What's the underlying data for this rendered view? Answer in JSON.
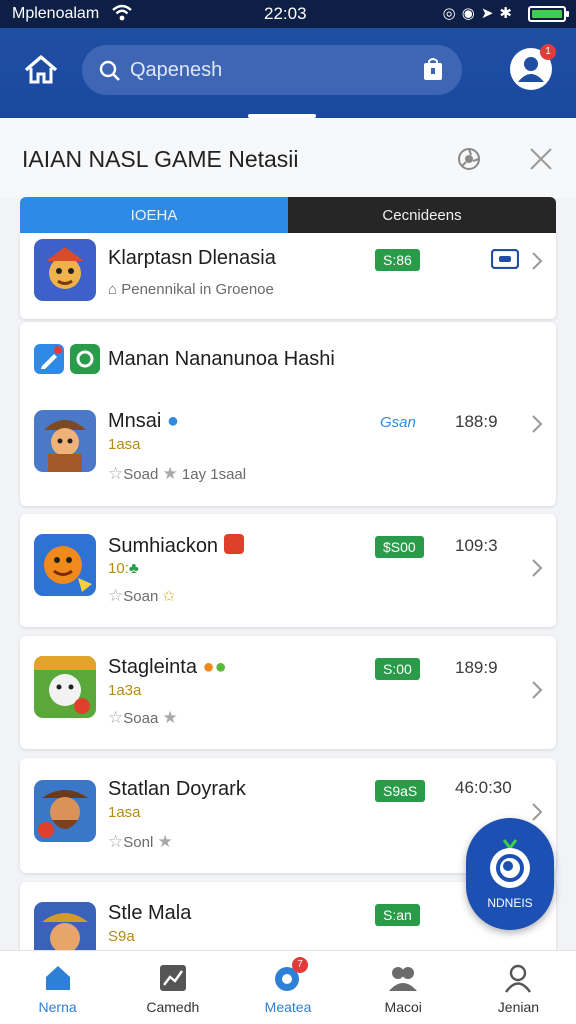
{
  "status_bar": {
    "carrier": "Mplenoalam",
    "time": "22:03",
    "battery_level": 1.0
  },
  "header": {
    "search_placeholder": "Qapenesh",
    "profile_badge": "1"
  },
  "title": "IAIAN NASL GAME Netasii",
  "tabs": [
    {
      "label": "IOEHA",
      "active": true
    },
    {
      "label": "Cecnideens",
      "active": false
    }
  ],
  "section_header": {
    "label": "Manan Nananunoa Hashi"
  },
  "games": [
    {
      "name": "Klarptasn Dlenasia",
      "meta": "Penennikal in Groenoe",
      "price": "S:86",
      "tag": ""
    },
    {
      "name": "Mnsai",
      "sub": "1asa",
      "meta1": "Soad",
      "meta2": "1ay  1saal",
      "tag": "Gsan",
      "score": "188:9"
    },
    {
      "name": "Sumhiackon",
      "sub": "10:",
      "meta1": "Soan",
      "price": "$S00",
      "score": "109:3"
    },
    {
      "name": "Stagleinta",
      "sub": "1a3a",
      "meta1": "Soaa",
      "price": "S:00",
      "score": "189:9"
    },
    {
      "name": "Statlan Doyrark",
      "sub": "1asa",
      "meta1": "Sonl",
      "price": "S9aS",
      "score": "46:0:30"
    },
    {
      "name": "Stle Mala",
      "sub": "S9a",
      "price": "S:an"
    }
  ],
  "fab": {
    "label": "NDNEIS"
  },
  "bottom_nav": [
    {
      "label": "Nerna",
      "icon": "home-icon",
      "active": true
    },
    {
      "label": "Camedh",
      "icon": "chart-icon",
      "active": false
    },
    {
      "label": "Meatea",
      "icon": "chat-icon",
      "active": false,
      "badge": "7"
    },
    {
      "label": "Macoi",
      "icon": "group-icon",
      "active": false
    },
    {
      "label": "Jenian",
      "icon": "profile-icon",
      "active": false
    }
  ],
  "colors": {
    "header": "#1f4ea3",
    "accent": "#2f8ae5",
    "price_green": "#2a9b48",
    "status": "#0d1f44"
  }
}
